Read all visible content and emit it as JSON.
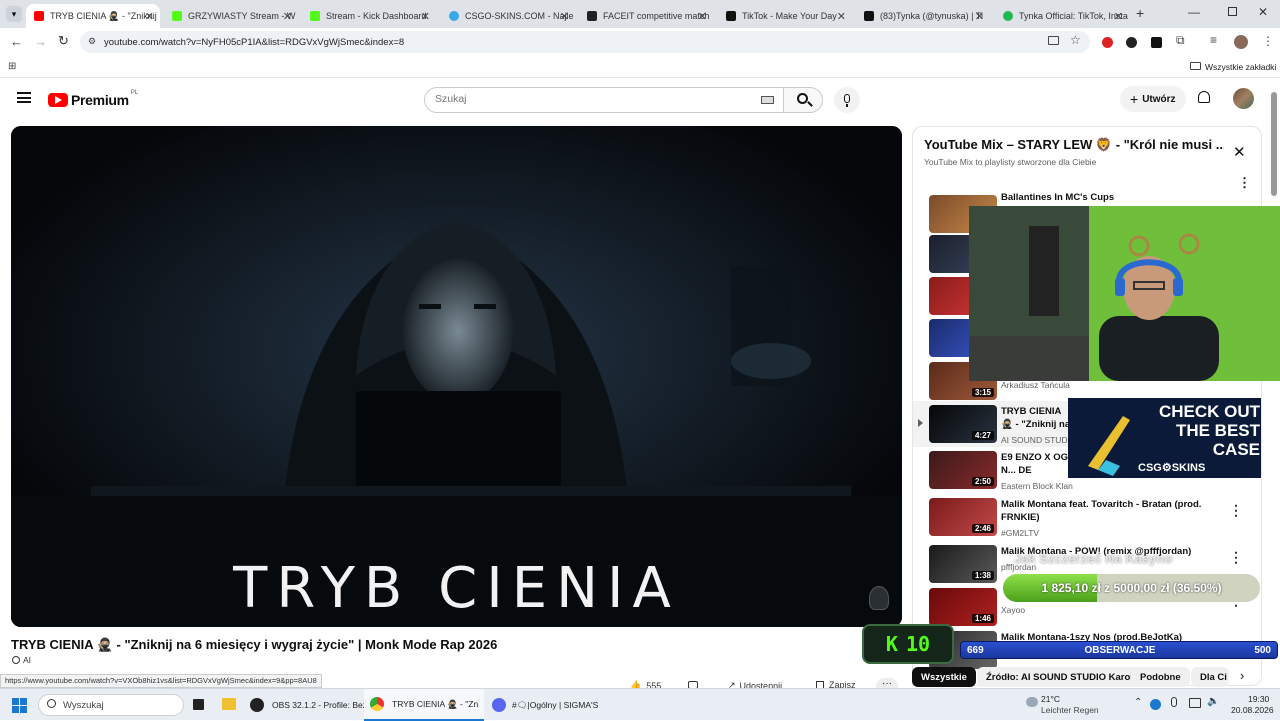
{
  "browser": {
    "tabs": [
      {
        "label": "TRYB CIENIA 🥷🏼 - \"Zniknij",
        "color": "#ff0000"
      },
      {
        "label": "GRZYWIASTY Stream - W",
        "color": "#53fc18"
      },
      {
        "label": "Stream - Kick Dashboard",
        "color": "#53fc18"
      },
      {
        "label": "CSGO-SKINS.COM - Najle",
        "color": "#3aa7e8"
      },
      {
        "label": "FACEIT competitive match",
        "color": "#222222"
      },
      {
        "label": "TikTok - Make Your Day",
        "color": "#111111"
      },
      {
        "label": "(83)Tynka (@tynuska) | Ti",
        "color": "#111111"
      },
      {
        "label": "Tynka Official: TikTok, Insta",
        "color": "#1db954"
      }
    ],
    "url": "youtube.com/watch?v=NyFH05cP1IA&list=RDGVxVgWjSmec&index=8",
    "bookmarks_label": "Wszystkie zakładki",
    "status_url": "https://www.youtube.com/watch?v=VXOb8hiz1vs&list=RDGVxVgWjSmec&index=9&pp=8AU8"
  },
  "youtube": {
    "logo_text": "Premium",
    "logo_region": "PL",
    "search_placeholder": "Szukaj",
    "create_label": "Utwórz"
  },
  "video": {
    "overlay_title": "TRYB CIENIA",
    "title": "TRYB CIENIA 🥷🏼 - \"Zniknij na 6 miesięcy i wygraj życie\" | Monk Mode Rap 2026",
    "ai_badge": "AI",
    "likes": "555",
    "share_label": "Udostępnij",
    "save_label": "Zapisz"
  },
  "playlist": {
    "title": "YouTube Mix – STARY LEW 🦁 - \"Król nie musi ...",
    "subtitle": "YouTube Mix to playlisty stworzone dla Ciebie",
    "items": [
      {
        "title": "Ballantines In MC's Cups",
        "channel": "",
        "duration": ""
      },
      {
        "title": "",
        "channel": "",
        "duration": ""
      },
      {
        "title": "",
        "channel": "",
        "duration": ""
      },
      {
        "title": "",
        "channel": "",
        "duration": ""
      },
      {
        "title": "",
        "channel": "Arkadiusz Tańcula",
        "duration": "3:15"
      },
      {
        "title": "TRYB CIENIA 🥷🏼 - \"Zniknij na 6 ... życie\" | Monk M",
        "channel": "AI SOUND STUDIO",
        "duration": "4:27"
      },
      {
        "title": "E9 ENZO X OG N... DE FAVELA)",
        "channel": "Eastern Block Klan",
        "duration": "2:50"
      },
      {
        "title": "Malik Montana feat. Tovaritch - Bratan (prod. FRNKIE)",
        "channel": "#GM2LTV",
        "duration": "2:46"
      },
      {
        "title": "Malik Montana - POW! (remix @pfffjordan)",
        "channel": "pfffjordan",
        "duration": "1:38"
      },
      {
        "title": "",
        "channel": "Xayoo",
        "duration": "1:46"
      },
      {
        "title": "Malik Montana-1szy Nos (prod.BeJotKa)",
        "channel": "",
        "duration": ""
      }
    ]
  },
  "chips": [
    "Wszystkie",
    "Źródło: AI SOUND STUDIO Karol",
    "Podobne",
    "Dla Ci"
  ],
  "overlays": {
    "ad_text": "CHECK OUT THE BEST CASE",
    "ad_brand": "CSG⚙SKINS",
    "goal_title": "Jak Szczerzeć Na Kasyno",
    "goal_text": "1 825,10 zł z 5000,00 zł (36.50%)",
    "goal_progress": 0.365,
    "kick_count": "10",
    "follow_left": "669",
    "follow_label": "OBSERWACJE",
    "follow_right": "500",
    "follow_progress": 0.0
  },
  "taskbar": {
    "search_placeholder": "Wyszukaj",
    "apps": [
      {
        "label": "OBS 32.1.2 - Profile: Bez"
      },
      {
        "label": "TRYB CIENIA 🥷🏼 - \"Znik"
      },
      {
        "label": "#🗨|Ogólny | SIGMA'S"
      }
    ],
    "weather_temp": "21°C",
    "weather_desc": "Leichter Regen",
    "time": "19:30",
    "date": "20.08.2026"
  }
}
